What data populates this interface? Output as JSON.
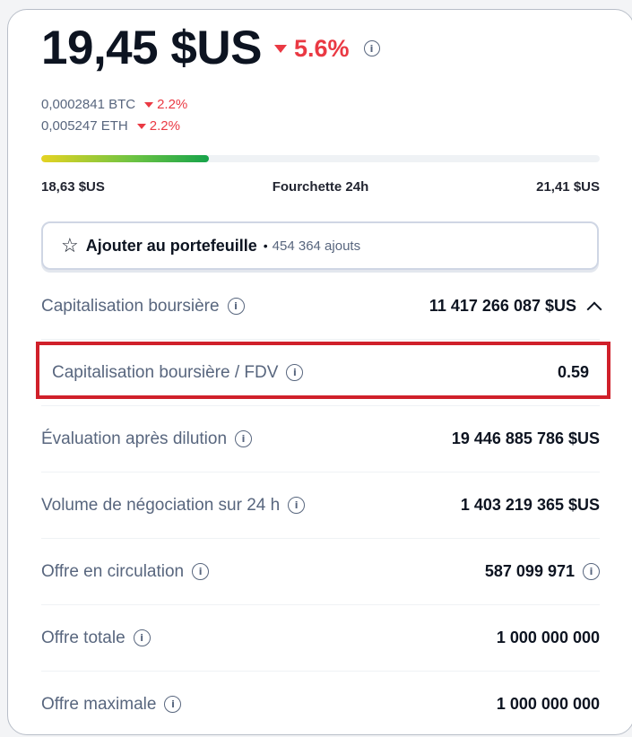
{
  "price": {
    "value": "19,45 $US",
    "change": "5.6%",
    "direction": "down",
    "down_color": "#ea3943"
  },
  "conversions": [
    {
      "amount": "0,0002841 BTC",
      "change": "2.2%"
    },
    {
      "amount": "0,005247 ETH",
      "change": "2.2%"
    }
  ],
  "range": {
    "low": "18,63 $US",
    "label": "Fourchette 24h",
    "high": "21,41 $US",
    "position_fraction": 0.3
  },
  "watchlist": {
    "star_icon": "star-outline-icon",
    "label": "Ajouter au portefeuille",
    "separator": "•",
    "count": "454 364 ajouts"
  },
  "stats": [
    {
      "label": "Capitalisation boursière",
      "value": "11 417 266 087 $US",
      "expandable": true
    },
    {
      "label": "Capitalisation boursière / FDV",
      "value": "0.59",
      "highlighted": true,
      "highlight_color": "#d0202a"
    },
    {
      "label": "Évaluation après dilution",
      "value": "19 446 885 786 $US"
    },
    {
      "label": "Volume de négociation sur 24 h",
      "value": "1 403 219 365 $US"
    },
    {
      "label": "Offre en circulation",
      "value": "587 099 971",
      "value_info": true
    },
    {
      "label": "Offre totale",
      "value": "1 000 000 000"
    },
    {
      "label": "Offre maximale",
      "value": "1 000 000 000"
    }
  ]
}
